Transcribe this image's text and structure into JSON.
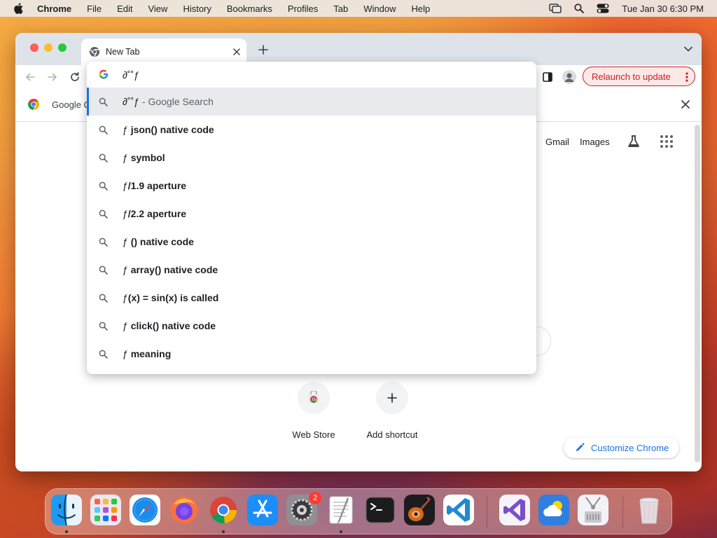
{
  "menubar": {
    "app_name": "Chrome",
    "items": [
      "File",
      "Edit",
      "View",
      "History",
      "Bookmarks",
      "Profiles",
      "Tab",
      "Window",
      "Help"
    ],
    "clock": "Tue Jan 30  6:30 PM"
  },
  "tab": {
    "title": "New Tab"
  },
  "toolbar": {
    "relaunch_label": "Relaunch to update"
  },
  "infobar": {
    "label": "Google C"
  },
  "omnibox": {
    "typed_text": "∂˚˚ƒ",
    "selected": {
      "query": "∂˚˚ƒ",
      "hint": " - Google Search"
    },
    "suggestions": [
      {
        "prefix": "ƒ ",
        "rest": "json() native code"
      },
      {
        "prefix": "ƒ ",
        "rest": "symbol"
      },
      {
        "prefix": "ƒ",
        "rest": "/1.9 aperture"
      },
      {
        "prefix": "ƒ",
        "rest": "/2.2 aperture"
      },
      {
        "prefix": "ƒ ",
        "rest": "() native code"
      },
      {
        "prefix": "ƒ ",
        "rest": "array() native code"
      },
      {
        "prefix": "ƒ",
        "rest": "(x) = sin(x) is called"
      },
      {
        "prefix": "ƒ ",
        "rest": "click() native code"
      },
      {
        "prefix": "ƒ ",
        "rest": "meaning"
      }
    ]
  },
  "newtab_page": {
    "links": {
      "gmail": "Gmail",
      "images": "Images"
    },
    "shortcuts": [
      {
        "label": "Web Store"
      },
      {
        "label": "Add shortcut"
      }
    ],
    "customize_label": "Customize Chrome"
  },
  "dock": {
    "apps": [
      "Finder",
      "Launchpad",
      "Safari",
      "Firefox",
      "Google Chrome",
      "App Store",
      "System Settings",
      "TextEdit",
      "Terminal",
      "GarageBand",
      "Visual Studio Code",
      "Visual Studio",
      "Weather",
      "Archive Utility",
      "Trash"
    ],
    "system_settings_badge": "2"
  },
  "colors": {
    "accent_blue": "#1a73e8",
    "relaunch_red": "#c5221f",
    "tabstrip": "#dee3ea"
  }
}
